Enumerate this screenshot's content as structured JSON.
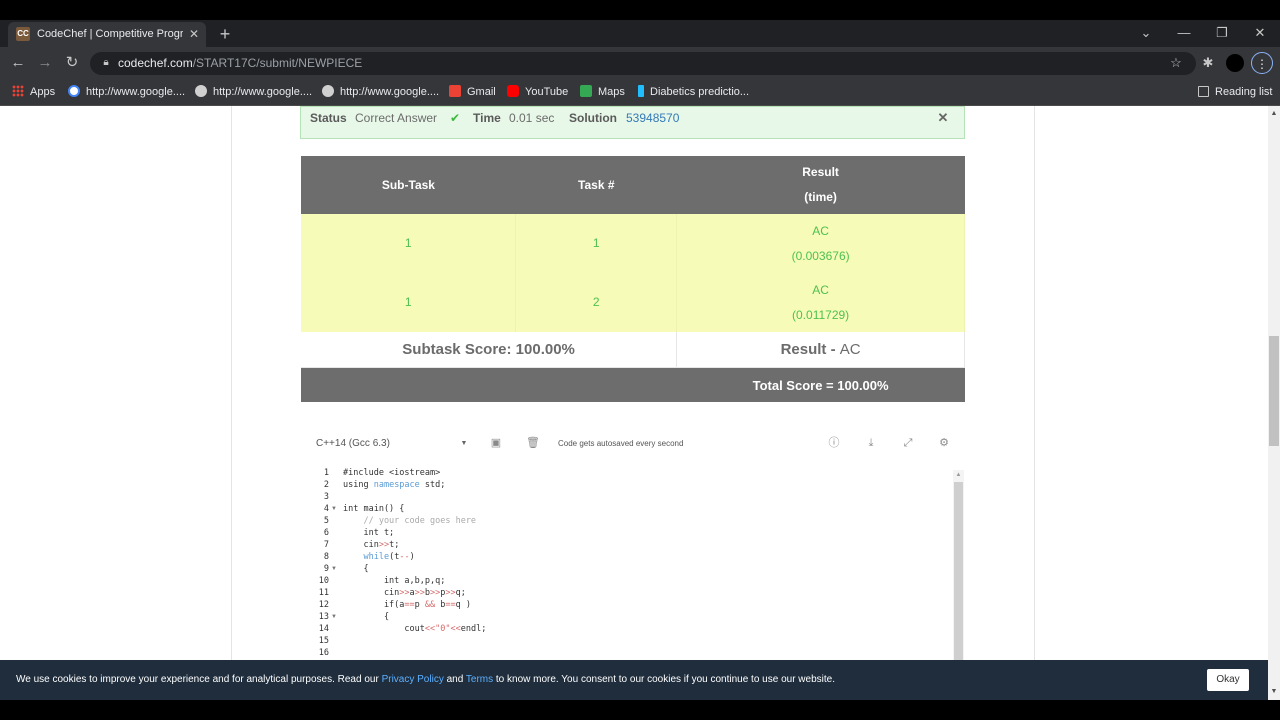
{
  "browser": {
    "tab_title": "CodeChef | Competitive Programming",
    "favicon_text": "CC",
    "url_host": "codechef.com",
    "url_path": "/START17C/submit/NEWPIECE",
    "bookmarks": [
      {
        "label": "Apps"
      },
      {
        "label": "http://www.google...."
      },
      {
        "label": "http://www.google...."
      },
      {
        "label": "http://www.google...."
      },
      {
        "label": "Gmail"
      },
      {
        "label": "YouTube"
      },
      {
        "label": "Maps"
      },
      {
        "label": "Diabetics predictio..."
      }
    ],
    "reading_list": "Reading list"
  },
  "status": {
    "status_label": "Status",
    "status_value": "Correct Answer",
    "time_label": "Time",
    "time_value": "0.01 sec",
    "solution_label": "Solution",
    "solution_value": "53948570"
  },
  "results_table": {
    "headers": {
      "subtask": "Sub-Task",
      "task": "Task #",
      "result_line1": "Result",
      "result_line2": "(time)"
    },
    "rows": [
      {
        "subtask": "1",
        "task": "1",
        "result": "AC",
        "time": "(0.003676)"
      },
      {
        "subtask": "1",
        "task": "2",
        "result": "AC",
        "time": "(0.011729)"
      }
    ],
    "subtask_score": "Subtask Score: 100.00%",
    "result_label": "Result -",
    "result_value": "AC",
    "total_score": "Total Score = 100.00%"
  },
  "editor": {
    "language": "C++14 (Gcc 6.3)",
    "autosave_note": "Code gets autosaved every second",
    "lines": [
      "1",
      "2",
      "3",
      "4",
      "5",
      "6",
      "7",
      "8",
      "9",
      "10",
      "11",
      "12",
      "13",
      "14",
      "15",
      "16"
    ]
  },
  "cookie": {
    "text_before": "We use cookies to improve your experience and for analytical purposes. Read our ",
    "privacy": "Privacy Policy",
    "and": " and ",
    "terms": "Terms",
    "text_after": " to know more. You consent to our cookies if you continue to use our website.",
    "button": "Okay"
  }
}
